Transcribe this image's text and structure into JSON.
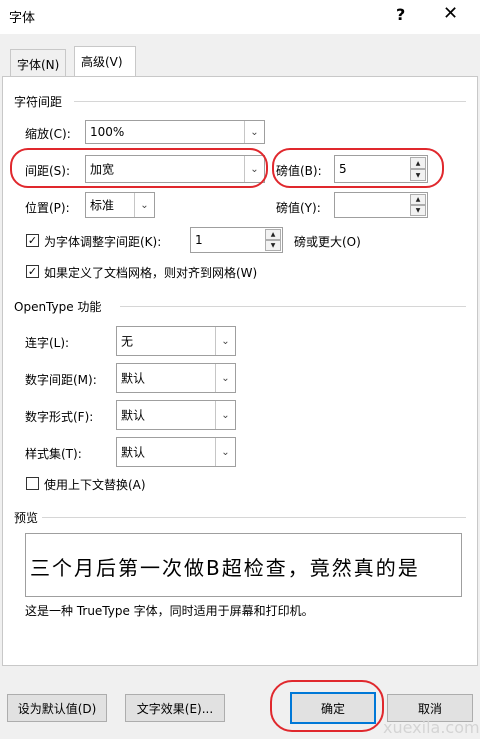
{
  "dialog": {
    "title": "字体",
    "help": "?",
    "close": "✕"
  },
  "tabs": [
    {
      "label": "字体(N)",
      "active": false
    },
    {
      "label": "高级(V)",
      "active": true
    }
  ],
  "char_spacing": {
    "section_title": "字符间距",
    "scale": {
      "label": "缩放(C):",
      "value": "100%"
    },
    "spacing": {
      "label": "间距(S):",
      "value": "加宽",
      "by_label": "磅值(B):",
      "by_value": "5"
    },
    "position": {
      "label": "位置(P):",
      "value": "标准",
      "by_label": "磅值(Y):",
      "by_value": ""
    },
    "kerning": {
      "checked": true,
      "label": "为字体调整字间距(K):",
      "value": "1",
      "suffix": "磅或更大(O)"
    },
    "snap_grid": {
      "checked": true,
      "label": "如果定义了文档网格，则对齐到网格(W)"
    }
  },
  "opentype": {
    "section_title": "OpenType 功能",
    "ligatures": {
      "label": "连字(L):",
      "value": "无"
    },
    "num_spacing": {
      "label": "数字间距(M):",
      "value": "默认"
    },
    "num_forms": {
      "label": "数字形式(F):",
      "value": "默认"
    },
    "stylistic_sets": {
      "label": "样式集(T):",
      "value": "默认"
    },
    "contextual_alt": {
      "checked": false,
      "label": "使用上下文替换(A)"
    }
  },
  "preview": {
    "section_title": "预览",
    "sample": "三个月后第一次做B超检查，竟然真的是",
    "note": "这是一种 TrueType 字体，同时适用于屏幕和打印机。"
  },
  "buttons": {
    "set_default": "设为默认值(D)",
    "text_effects": "文字效果(E)...",
    "ok": "确定",
    "cancel": "取消"
  },
  "watermark": "xuexila.com",
  "colors": {
    "highlight_ring": "#e0282d",
    "accent": "#0078d7"
  }
}
